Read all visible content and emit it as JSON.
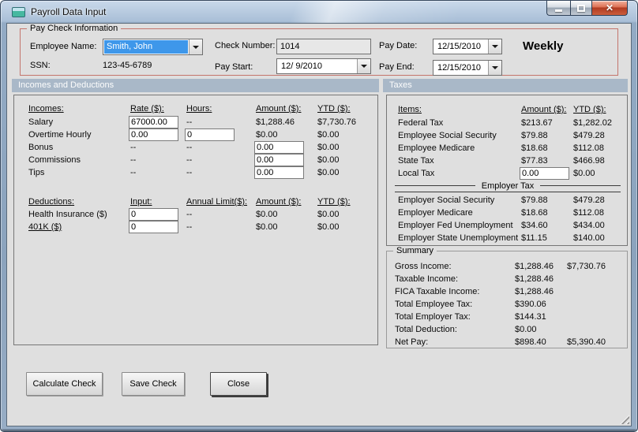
{
  "window": {
    "title": "Payroll Data Input"
  },
  "icons": {
    "app": "form-icon",
    "minimize": "minimize-icon",
    "maximize": "maximize-icon",
    "close": "close-icon",
    "dropdown": "chevron-down-icon",
    "resize": "resize-grip-icon"
  },
  "colors": {
    "band": "#A9B8C8",
    "selection_blue": "#3E97EA",
    "paycheck_border_red": "#C4756C",
    "client_bg": "#DFDFDF",
    "close_button_red": "#C14A31"
  },
  "paycheck": {
    "legend": "Pay Check Information",
    "employee_name_label": "Employee Name:",
    "employee_name_value": "Smith, John",
    "ssn_label": "SSN:",
    "ssn_value": "123-45-6789",
    "check_number_label": "Check Number:",
    "check_number_value": "1014",
    "pay_start_label": "Pay Start:",
    "pay_start_value": "12/ 9/2010",
    "pay_date_label": "Pay Date:",
    "pay_date_value": "12/15/2010",
    "pay_end_label": "Pay End:",
    "pay_end_value": "12/15/2010",
    "frequency": "Weekly"
  },
  "bands": {
    "left": "Incomes and Deductions",
    "right": "Taxes"
  },
  "incomes": {
    "headers": {
      "name": "Incomes:",
      "rate": "Rate ($):",
      "hours": "Hours:",
      "amount": "Amount ($):",
      "ytd": "YTD ($):"
    },
    "rows": [
      {
        "name": "Salary",
        "rate": "67000.00",
        "hours": "--",
        "amount": "$1,288.46",
        "ytd": "$7,730.76"
      },
      {
        "name": "Overtime Hourly",
        "rate": "0.00",
        "hours": "0",
        "amount": "$0.00",
        "ytd": "$0.00"
      },
      {
        "name": "Bonus",
        "rate": "--",
        "hours": "--",
        "amount": "0.00",
        "ytd": "$0.00"
      },
      {
        "name": "Commissions",
        "rate": "--",
        "hours": "--",
        "amount": "0.00",
        "ytd": "$0.00"
      },
      {
        "name": "Tips",
        "rate": "--",
        "hours": "--",
        "amount": "0.00",
        "ytd": "$0.00"
      }
    ]
  },
  "deductions": {
    "headers": {
      "name": "Deductions:",
      "input": "Input:",
      "limit": "Annual Limit($):",
      "amount": "Amount ($):",
      "ytd": "YTD ($):"
    },
    "rows": [
      {
        "name": "Health Insurance  ($)",
        "input": "0",
        "limit": "--",
        "amount": "$0.00",
        "ytd": "$0.00"
      },
      {
        "name": "401K  ($)",
        "input": "0",
        "limit": "--",
        "amount": "$0.00",
        "ytd": "$0.00"
      }
    ]
  },
  "taxes": {
    "headers": {
      "name": "Items:",
      "amount": "Amount ($):",
      "ytd": "YTD ($):"
    },
    "employee_rows": [
      {
        "name": "Federal Tax",
        "amount": "$213.67",
        "ytd": "$1,282.02"
      },
      {
        "name": "Employee Social Security",
        "amount": "$79.88",
        "ytd": "$479.28"
      },
      {
        "name": "Employee Medicare",
        "amount": "$18.68",
        "ytd": "$112.08"
      },
      {
        "name": "State Tax",
        "amount": "$77.83",
        "ytd": "$466.98"
      },
      {
        "name": "Local Tax",
        "amount": "0.00",
        "ytd": "$0.00"
      }
    ],
    "employer_header": "Employer Tax",
    "employer_rows": [
      {
        "name": "Employer Social Security",
        "amount": "$79.88",
        "ytd": "$479.28"
      },
      {
        "name": "Employer Medicare",
        "amount": "$18.68",
        "ytd": "$112.08"
      },
      {
        "name": "Employer Fed Unemployment",
        "amount": "$34.60",
        "ytd": "$434.00"
      },
      {
        "name": "Employer State Unemployment",
        "amount": "$11.15",
        "ytd": "$140.00"
      }
    ]
  },
  "summary": {
    "legend": "Summary",
    "rows": [
      {
        "name": "Gross Income:",
        "amount": "$1,288.46",
        "ytd": "$7,730.76"
      },
      {
        "name": "Taxable Income:",
        "amount": "$1,288.46",
        "ytd": ""
      },
      {
        "name": "FICA Taxable Income:",
        "amount": "$1,288.46",
        "ytd": ""
      },
      {
        "name": "Total Employee Tax:",
        "amount": "$390.06",
        "ytd": ""
      },
      {
        "name": "Total Employer Tax:",
        "amount": "$144.31",
        "ytd": ""
      },
      {
        "name": "Total Deduction:",
        "amount": "$0.00",
        "ytd": ""
      },
      {
        "name": "Net Pay:",
        "amount": "$898.40",
        "ytd": "$5,390.40"
      }
    ]
  },
  "buttons": {
    "calculate": "Calculate Check",
    "save": "Save Check",
    "close": "Close"
  }
}
